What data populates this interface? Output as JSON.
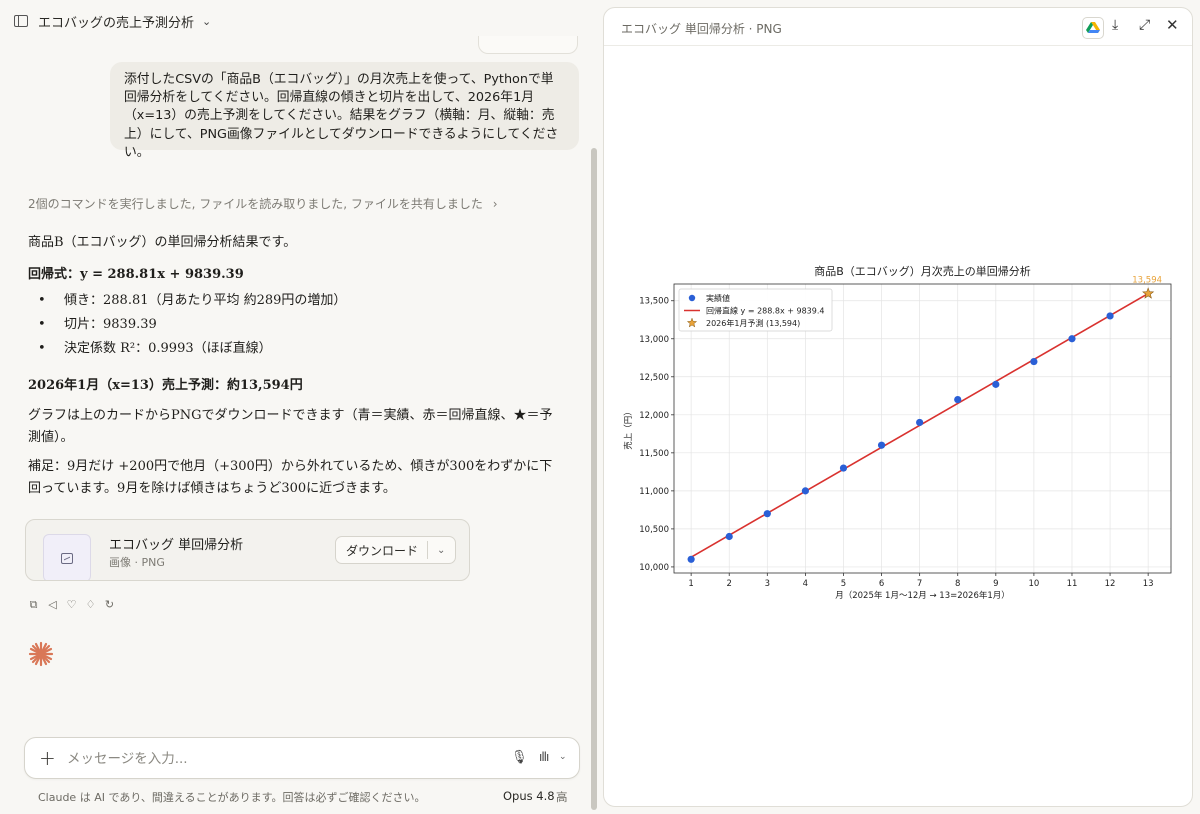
{
  "left": {
    "chat_title": "エコバッグの売上予測分析",
    "user_message": "添付したCSVの「商品B（エコバッグ）」の月次売上を使って、Pythonで単回帰分析をしてください。回帰直線の傾きと切片を出して、2026年1月（x=13）の売上予測をしてください。結果をグラフ（横軸：月、縦軸：売上）にして、PNG画像ファイルとしてダウンロードできるようにしてください。",
    "tool_summary": "2個のコマンドを実行しました, ファイルを読み取りました, ファイルを共有しました",
    "tool_summary_chevron": "›",
    "answer": {
      "intro": "商品B（エコバッグ）の単回帰分析結果です。",
      "equation": "回帰式：y = 288.81x + 9839.39",
      "bullets": [
        "傾き：288.81（月あたり平均 約289円の増加）",
        "切片：9839.39",
        "決定係数 R²：0.9993（ほぼ直線）"
      ],
      "prediction": "2026年1月（x=13）売上予測：約13,594円",
      "para1": "グラフは上のカードからPNGでダウンロードできます（青＝実績、赤＝回帰直線、★＝予測値）。",
      "para2": "補足：9月だけ +200円で他月（+300円）から外れているため、傾きが300をわずかに下回っています。9月を除けば傾きはちょうど300に近づきます。"
    },
    "file_card": {
      "name": "エコバッグ 単回帰分析",
      "type": "画像 · PNG",
      "download_label": "ダウンロード",
      "chevron": "⌄"
    },
    "actions": [
      "copy-icon",
      "speaker-icon",
      "thumbs-up-icon",
      "thumbs-down-icon",
      "retry-icon"
    ],
    "composer": {
      "placeholder": "メッセージを入力...",
      "plus": "+"
    },
    "disclaimer": "Claude は AI であり、間違えることがあります。回答は必ずご確認ください。",
    "model": "Opus 4.8",
    "effort": "高"
  },
  "right": {
    "panel_title": "エコバッグ 単回帰分析 · PNG",
    "icons": [
      "google-drive-icon",
      "download-icon",
      "expand-icon",
      "close-icon"
    ]
  },
  "chart_data": {
    "type": "scatter",
    "title": "商品B（エコバッグ）月次売上の単回帰分析",
    "xlabel": "月（2025年 1月〜12月 → 13=2026年1月）",
    "ylabel": "売上（円）",
    "x_ticks": [
      1,
      2,
      3,
      4,
      5,
      6,
      7,
      8,
      9,
      10,
      11,
      12,
      13
    ],
    "y_ticks": [
      10000,
      10500,
      11000,
      11500,
      12000,
      12500,
      13000,
      13500
    ],
    "y_tick_labels": [
      "10,000",
      "10,500",
      "11,000",
      "11,500",
      "12,000",
      "12,500",
      "13,000",
      "13,500"
    ],
    "xlim": [
      0.55,
      13.6
    ],
    "ylim": [
      9920,
      13720
    ],
    "grid": true,
    "legend_position": "top-left",
    "series": [
      {
        "name": "実績値",
        "kind": "points",
        "color": "#2a5fd6",
        "x": [
          1,
          2,
          3,
          4,
          5,
          6,
          7,
          8,
          9,
          10,
          11,
          12
        ],
        "y": [
          10100,
          10400,
          10700,
          11000,
          11300,
          11600,
          11900,
          12200,
          12400,
          12700,
          13000,
          13300
        ]
      },
      {
        "name": "回帰直線  y = 288.8x + 9839.4",
        "kind": "line",
        "color": "#d9322f",
        "slope": 288.81,
        "intercept": 9839.39,
        "x_range": [
          1,
          13
        ]
      },
      {
        "name": "2026年1月予測 (13,594)",
        "kind": "star",
        "color": "#e8a33b",
        "x": [
          13
        ],
        "y": [
          13594
        ]
      }
    ],
    "annotation": "13,594"
  },
  "colors": {
    "accent": "#d97757",
    "actual": "#2a5fd6",
    "regression": "#d9322f",
    "prediction": "#e8a33b"
  }
}
